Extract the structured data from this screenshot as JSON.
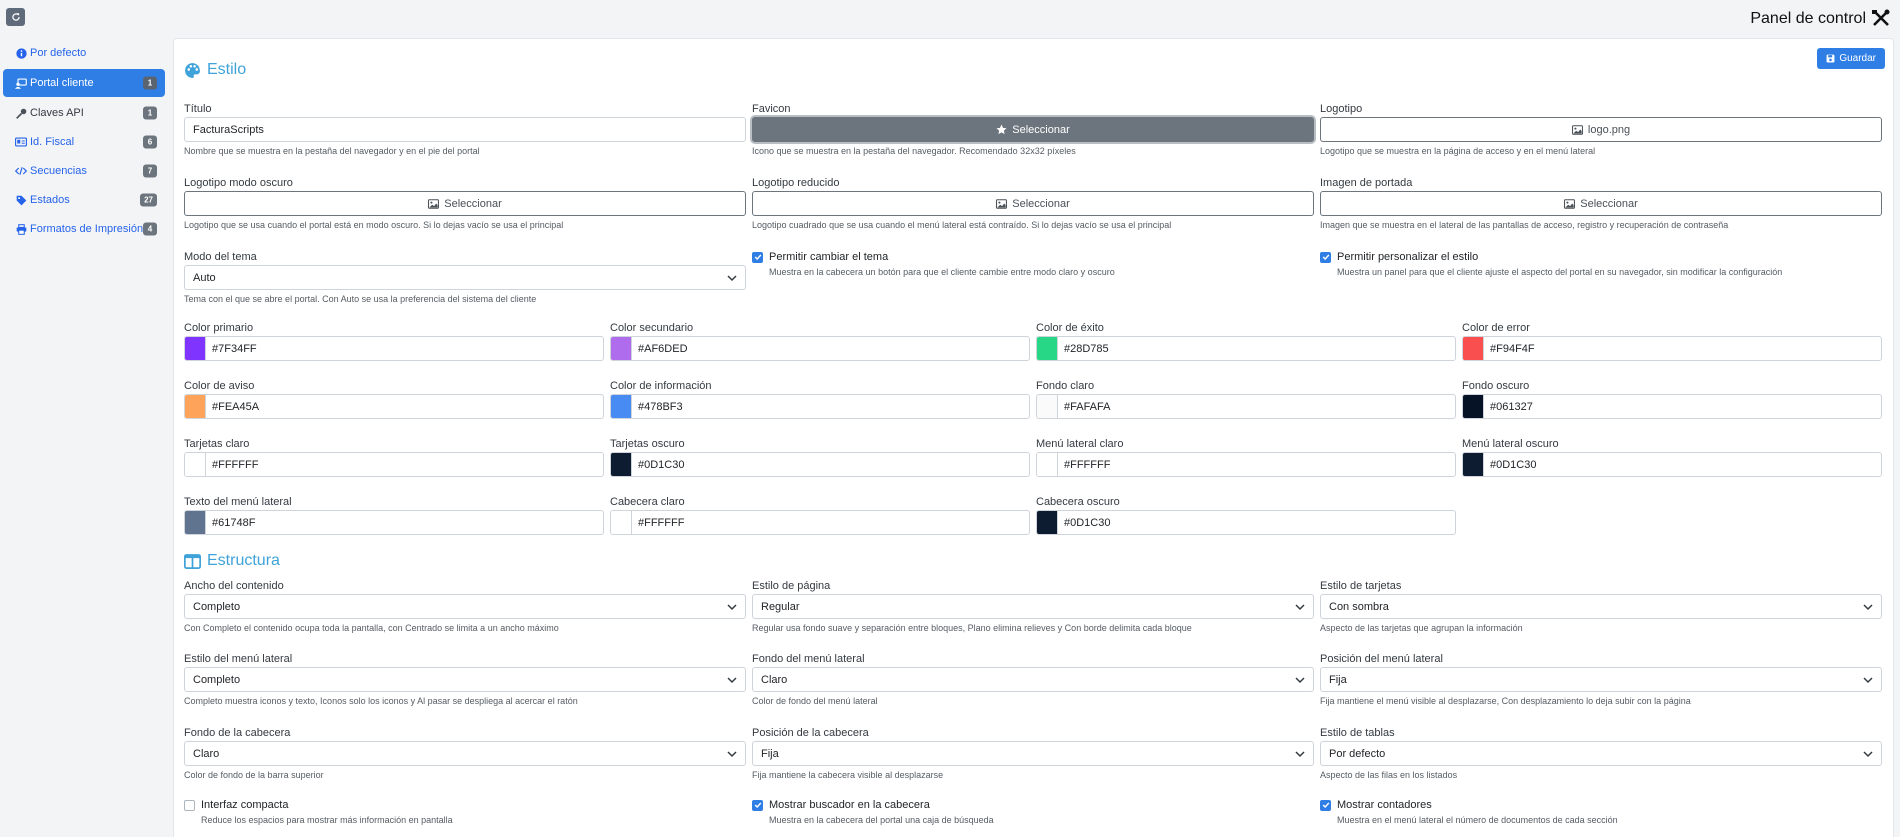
{
  "header": {
    "title": "Panel de control"
  },
  "sidebar": {
    "items": [
      {
        "label": "Por defecto",
        "icon": "info-circle-icon",
        "badge": null,
        "active": false
      },
      {
        "label": "Portal cliente",
        "icon": "person-display-icon",
        "badge": "1",
        "active": true
      },
      {
        "label": "Claves API",
        "icon": "key-icon",
        "badge": "1",
        "active": false
      },
      {
        "label": "Id. Fiscal",
        "icon": "id-card-icon",
        "badge": "6",
        "active": false
      },
      {
        "label": "Secuencias",
        "icon": "code-icon",
        "badge": "7",
        "active": false
      },
      {
        "label": "Estados",
        "icon": "tags-icon",
        "badge": "27",
        "active": false
      },
      {
        "label": "Formatos de Impresión",
        "icon": "printer-icon",
        "badge": "4",
        "active": false
      }
    ]
  },
  "toolbar": {
    "save_label": "Guardar"
  },
  "style": {
    "title": "Estilo",
    "fields": {
      "titulo": {
        "label": "Título",
        "value": "FacturaScripts",
        "help": "Nombre que se muestra en la pestaña del navegador y en el pie del portal"
      },
      "favicon": {
        "label": "Favicon",
        "button": "Seleccionar",
        "help": "Icono que se muestra en la pestaña del navegador. Recomendado 32x32 píxeles"
      },
      "logotipo": {
        "label": "Logotipo",
        "button": "logo.png",
        "help": "Logotipo que se muestra en la página de acceso y en el menú lateral"
      },
      "logo_oscuro": {
        "label": "Logotipo modo oscuro",
        "button": "Seleccionar",
        "help": "Logotipo que se usa cuando el portal está en modo oscuro. Si lo dejas vacío se usa el principal"
      },
      "logo_reducido": {
        "label": "Logotipo reducido",
        "button": "Seleccionar",
        "help": "Logotipo cuadrado que se usa cuando el menú lateral está contraído. Si lo dejas vacío se usa el principal"
      },
      "portada": {
        "label": "Imagen de portada",
        "button": "Seleccionar",
        "help": "Imagen que se muestra en el lateral de las pantallas de acceso, registro y recuperación de contraseña"
      },
      "modo_tema": {
        "label": "Modo del tema",
        "value": "Auto",
        "help": "Tema con el que se abre el portal. Con Auto se usa la preferencia del sistema del cliente"
      },
      "cambiar_tema": {
        "label": "Permitir cambiar el tema",
        "checked": true,
        "help": "Muestra en la cabecera un botón para que el cliente cambie entre modo claro y oscuro"
      },
      "personalizar": {
        "label": "Permitir personalizar el estilo",
        "checked": true,
        "help": "Muestra un panel para que el cliente ajuste el aspecto del portal en su navegador, sin modificar la configuración"
      }
    },
    "colors": [
      {
        "label": "Color primario",
        "value": "#7F34FF",
        "swatch": "#7F34FF"
      },
      {
        "label": "Color secundario",
        "value": "#AF6DED",
        "swatch": "#AF6DED"
      },
      {
        "label": "Color de éxito",
        "value": "#28D785",
        "swatch": "#28D785"
      },
      {
        "label": "Color de error",
        "value": "#F94F4F",
        "swatch": "#F94F4F"
      },
      {
        "label": "Color de aviso",
        "value": "#FEA45A",
        "swatch": "#FEA45A"
      },
      {
        "label": "Color de información",
        "value": "#478BF3",
        "swatch": "#478BF3"
      },
      {
        "label": "Fondo claro",
        "value": "#FAFAFA",
        "swatch": "#FAFAFA"
      },
      {
        "label": "Fondo oscuro",
        "value": "#061327",
        "swatch": "#061327"
      },
      {
        "label": "Tarjetas claro",
        "value": "#FFFFFF",
        "swatch": "#FFFFFF"
      },
      {
        "label": "Tarjetas oscuro",
        "value": "#0D1C30",
        "swatch": "#0D1C30"
      },
      {
        "label": "Menú lateral claro",
        "value": "#FFFFFF",
        "swatch": "#FFFFFF"
      },
      {
        "label": "Menú lateral oscuro",
        "value": "#0D1C30",
        "swatch": "#0D1C30"
      },
      {
        "label": "Texto del menú lateral",
        "value": "#61748F",
        "swatch": "#61748F"
      },
      {
        "label": "Cabecera claro",
        "value": "#FFFFFF",
        "swatch": "#FFFFFF"
      },
      {
        "label": "Cabecera oscuro",
        "value": "#0D1C30",
        "swatch": "#0D1C30"
      }
    ]
  },
  "structure": {
    "title": "Estructura",
    "selects": [
      {
        "label": "Ancho del contenido",
        "value": "Completo",
        "help": "Con Completo el contenido ocupa toda la pantalla, con Centrado se limita a un ancho máximo"
      },
      {
        "label": "Estilo de página",
        "value": "Regular",
        "help": "Regular usa fondo suave y separación entre bloques, Plano elimina relieves y Con borde delimita cada bloque"
      },
      {
        "label": "Estilo de tarjetas",
        "value": "Con sombra",
        "help": "Aspecto de las tarjetas que agrupan la información"
      },
      {
        "label": "Estilo del menú lateral",
        "value": "Completo",
        "help": "Completo muestra iconos y texto, Iconos solo los iconos y Al pasar se despliega al acercar el ratón"
      },
      {
        "label": "Fondo del menú lateral",
        "value": "Claro",
        "help": "Color de fondo del menú lateral"
      },
      {
        "label": "Posición del menú lateral",
        "value": "Fija",
        "help": "Fija mantiene el menú visible al desplazarse, Con desplazamiento lo deja subir con la página"
      },
      {
        "label": "Fondo de la cabecera",
        "value": "Claro",
        "help": "Color de fondo de la barra superior"
      },
      {
        "label": "Posición de la cabecera",
        "value": "Fija",
        "help": "Fija mantiene la cabecera visible al desplazarse"
      },
      {
        "label": "Estilo de tablas",
        "value": "Por defecto",
        "help": "Aspecto de las filas en los listados"
      }
    ],
    "checks": [
      {
        "label": "Interfaz compacta",
        "checked": false,
        "help": "Reduce los espacios para mostrar más información en pantalla"
      },
      {
        "label": "Mostrar buscador en la cabecera",
        "checked": true,
        "help": "Muestra en la cabecera del portal una caja de búsqueda"
      },
      {
        "label": "Mostrar contadores",
        "checked": true,
        "help": "Muestra en el menú lateral el número de documentos de cada sección"
      }
    ]
  }
}
